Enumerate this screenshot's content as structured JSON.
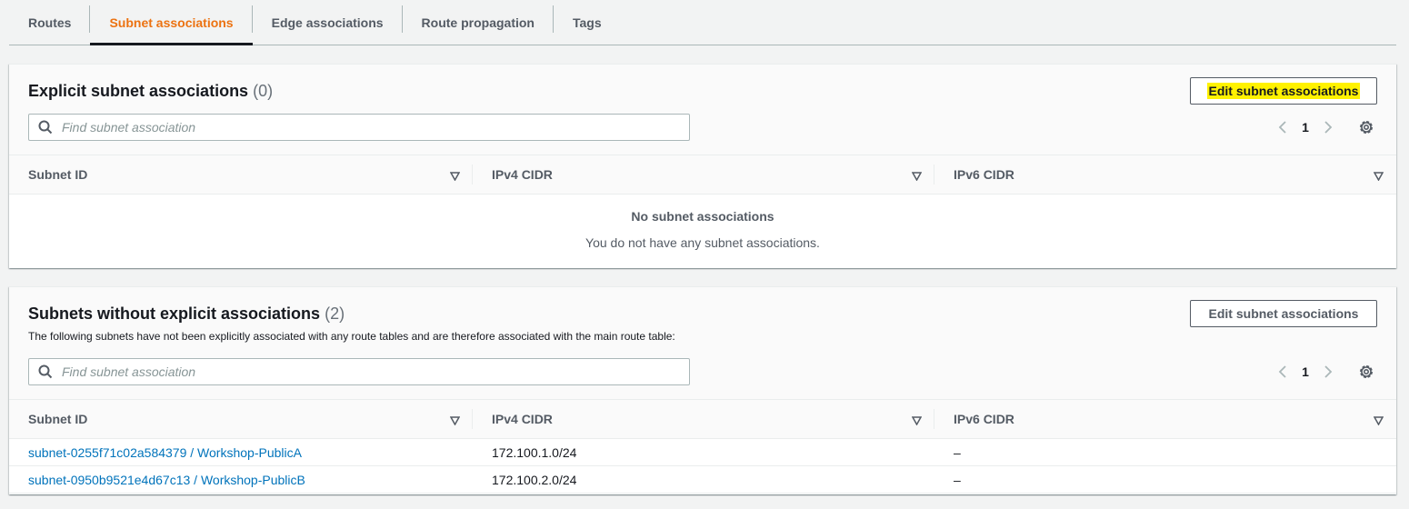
{
  "tabs": [
    {
      "label": "Routes"
    },
    {
      "label": "Subnet associations",
      "active": true
    },
    {
      "label": "Edge associations"
    },
    {
      "label": "Route propagation"
    },
    {
      "label": "Tags"
    }
  ],
  "explicit": {
    "title": "Explicit subnet associations",
    "count": "(0)",
    "edit_label": "Edit subnet associations",
    "search_placeholder": "Find subnet association",
    "page": "1",
    "columns": [
      "Subnet ID",
      "IPv4 CIDR",
      "IPv6 CIDR"
    ],
    "empty_title": "No subnet associations",
    "empty_text": "You do not have any subnet associations."
  },
  "implicit": {
    "title": "Subnets without explicit associations",
    "count": "(2)",
    "description": "The following subnets have not been explicitly associated with any route tables and are therefore associated with the main route table:",
    "edit_label": "Edit subnet associations",
    "search_placeholder": "Find subnet association",
    "page": "1",
    "columns": [
      "Subnet ID",
      "IPv4 CIDR",
      "IPv6 CIDR"
    ],
    "rows": [
      {
        "subnet": "subnet-0255f71c02a584379 / Workshop-PublicA",
        "ipv4": "172.100.1.0/24",
        "ipv6": "–"
      },
      {
        "subnet": "subnet-0950b9521e4d67c13 / Workshop-PublicB",
        "ipv4": "172.100.2.0/24",
        "ipv6": "–"
      }
    ]
  },
  "colors": {
    "accent": "#ec7211",
    "link": "#0073bb",
    "highlight": "#fff200"
  }
}
